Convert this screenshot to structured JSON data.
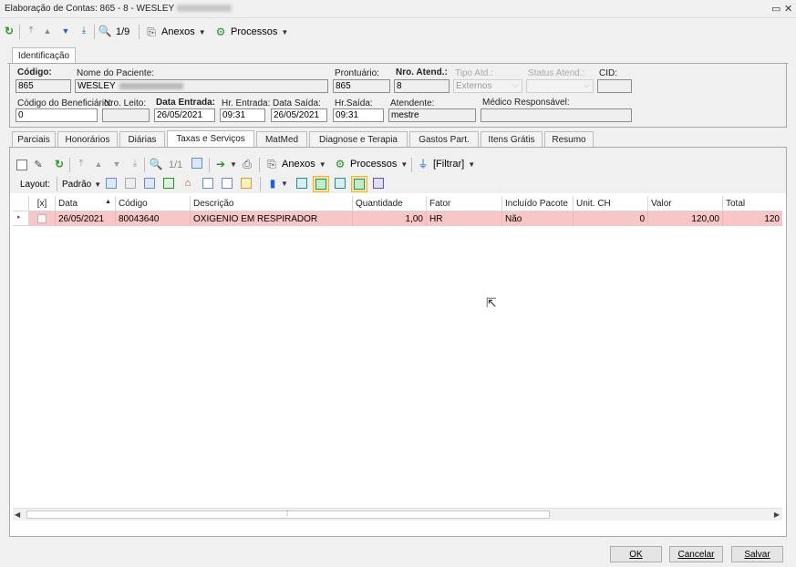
{
  "window": {
    "title": "Elaboração de Contas: 865 - 8 - WESLEY",
    "minimize_glyph": "▭",
    "close_glyph": "✕"
  },
  "main_toolbar": {
    "record_counter": "1/9",
    "anexos_label": "Anexos",
    "processos_label": "Processos"
  },
  "top_tab": "Identificação",
  "identification": {
    "codigo_label": "Código:",
    "codigo_value": "865",
    "nome_label": "Nome do Paciente:",
    "nome_value": "WESLEY",
    "prontuario_label": "Prontuário:",
    "prontuario_value": "865",
    "nro_atend_label": "Nro. Atend.:",
    "nro_atend_value": "8",
    "tipo_atd_label": "Tipo Atd.:",
    "tipo_atd_value": "Externos",
    "status_atend_label": "Status Atend.:",
    "status_atend_value": "",
    "cid_label": "CID:",
    "cid_value": "",
    "cod_benef_label": "Código do Beneficiário:",
    "cod_benef_value": "0",
    "nro_leito_label": "Nro. Leito:",
    "nro_leito_value": "",
    "data_entrada_label": "Data Entrada:",
    "data_entrada_value": "26/05/2021",
    "hr_entrada_label": "Hr. Entrada:",
    "hr_entrada_value": "09:31",
    "data_saida_label": "Data Saída:",
    "data_saida_value": "26/05/2021",
    "hr_saida_label": "Hr.Saída:",
    "hr_saida_value": "09:31",
    "atendente_label": "Atendente:",
    "atendente_value": "mestre",
    "medico_label": "Médico Responsável:",
    "medico_value": ""
  },
  "section_tabs": [
    "Parciais",
    "Honorários",
    "Diárias",
    "Taxas e Serviços",
    "MatMed",
    "Diagnose e Terapia",
    "Gastos Part.",
    "Itens Grátis",
    "Resumo"
  ],
  "active_section_tab": "Taxas e Serviços",
  "grid_toolbar": {
    "record_counter": "1/1",
    "anexos_label": "Anexos",
    "processos_label": "Processos",
    "filtrar_label": "[Filtrar]",
    "layout_label": "Layout:",
    "layout_value": "Padrão"
  },
  "grid": {
    "columns": [
      "[x]",
      "Data",
      "Código",
      "Descrição",
      "Quantidade",
      "Fator",
      "Incluído Pacote",
      "Unit. CH",
      "Valor",
      "Total"
    ],
    "rows": [
      {
        "checked": false,
        "data": "26/05/2021",
        "codigo": "80043640",
        "descricao": "OXIGENIO EM RESPIRADOR",
        "quantidade": "1,00",
        "fator": "HR",
        "incluido_pacote": "Não",
        "unit_ch": "0",
        "valor": "120,00",
        "total": "120"
      }
    ],
    "sort_column": "Data",
    "selected_row_color": "#f7c6c6"
  },
  "buttons": {
    "ok": "OK",
    "cancelar": "Cancelar",
    "salvar": "Salvar"
  }
}
